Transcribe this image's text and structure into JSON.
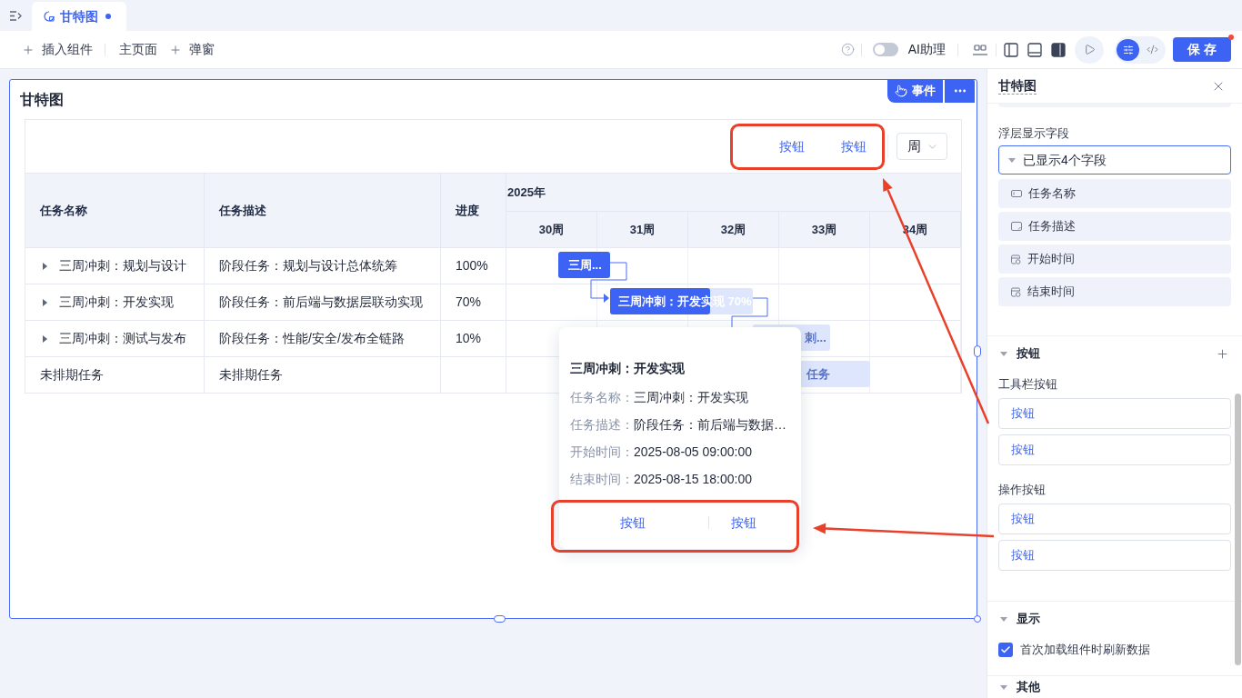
{
  "tab_bar": {
    "tabs": [
      {
        "label": "甘特图",
        "selected": true,
        "modified": true
      }
    ]
  },
  "toolbar": {
    "items": [
      {
        "kind": "add",
        "label": "插入组件"
      },
      {
        "kind": "page",
        "label": "主页面"
      },
      {
        "kind": "add",
        "label": "弹窗"
      }
    ],
    "ai_assistant": {
      "label": "AI助理",
      "on": false
    },
    "panels": [
      {
        "kind": "left",
        "selected": false
      },
      {
        "kind": "bottom",
        "selected": false
      },
      {
        "kind": "right",
        "selected": true
      }
    ],
    "modes": [
      {
        "kind": "settings",
        "selected": true
      },
      {
        "kind": "code",
        "selected": false
      }
    ],
    "save": {
      "label": "保 存",
      "badge": true
    }
  },
  "component": {
    "title": "甘特图",
    "event_label": "事件",
    "gantt": {
      "toolbar_buttons": [
        "按钮",
        "按钮"
      ],
      "scale": "周",
      "columns": [
        "任务名称",
        "任务描述",
        "进度"
      ],
      "year": "2025年",
      "weeks": [
        "30周",
        "31周",
        "32周",
        "33周",
        "34周"
      ],
      "rows": [
        {
          "name": "三周冲刺：规划与设计",
          "description": "阶段任务：规划与设计总体统筹",
          "progress": "100%",
          "expandable": true,
          "bar": {
            "label": "三周...",
            "level": 1
          }
        },
        {
          "name": "三周冲刺：开发实现",
          "description": "阶段任务：前后端与数据层联动实现",
          "progress": "70%",
          "expandable": true,
          "bar": {
            "label": "三周冲刺：开发实现 70%",
            "level": 0.7
          }
        },
        {
          "name": "三周冲刺：测试与发布",
          "description": "阶段任务：性能/安全/发布全链路",
          "progress": "10%",
          "expandable": true,
          "bar": {
            "label": "刺..."
          }
        },
        {
          "name": "未排期任务",
          "description": "未排期任务",
          "expandable": false,
          "bar": {
            "label": "任务"
          }
        }
      ]
    },
    "tooltip": {
      "title": "三周冲刺：开发实现",
      "fields": [
        {
          "label": "任务名称：",
          "value": "三周冲刺：开发实现"
        },
        {
          "label": "任务描述：",
          "value": "阶段任务：前后端与数据…"
        },
        {
          "label": "开始时间：",
          "value": "2025-08-05 09:00:00"
        },
        {
          "label": "结束时间：",
          "value": "2025-08-15 18:00:00"
        }
      ],
      "buttons": [
        "按钮",
        "按钮"
      ]
    }
  },
  "properties_panel": {
    "title": "甘特图",
    "tooltip_fields": {
      "label": "浮层显示字段",
      "summary": "已显示4个字段",
      "expanded": true,
      "fields": [
        {
          "kind": "input",
          "label": "任务名称"
        },
        {
          "kind": "textarea",
          "label": "任务描述"
        },
        {
          "kind": "datetime",
          "label": "开始时间"
        },
        {
          "kind": "datetime",
          "label": "结束时间"
        }
      ]
    },
    "sections": [
      {
        "kind": "buttons",
        "title": "按钮",
        "expanded": true,
        "groups": [
          {
            "label": "工具栏按钮",
            "buttons": [
              "按钮",
              "按钮"
            ]
          },
          {
            "label": "操作按钮",
            "buttons": [
              "按钮",
              "按钮"
            ]
          }
        ]
      },
      {
        "kind": "display",
        "title": "显示",
        "expanded": true,
        "options": [
          {
            "label": "首次加载组件时刷新数据",
            "checked": true
          }
        ]
      },
      {
        "kind": "other",
        "title": "其他",
        "expanded": true
      }
    ]
  }
}
